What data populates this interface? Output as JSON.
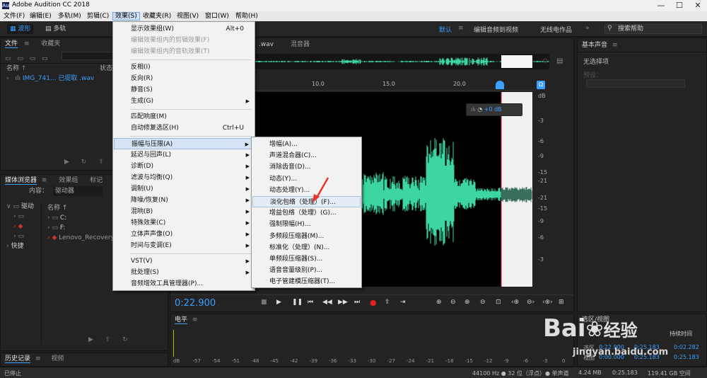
{
  "app": {
    "title": "Adobe Audition CC 2018",
    "icon_text": "Au"
  },
  "window": {
    "min": "—",
    "max": "☐",
    "close": "✕"
  },
  "menubar": [
    "文件(F)",
    "编辑(E)",
    "多轨(M)",
    "剪辑(C)",
    "效果(S)",
    "收藏夹(R)",
    "视图(V)",
    "窗口(W)",
    "帮助(H)"
  ],
  "toolbar": {
    "waveform": "波形",
    "multitrack": "多轨",
    "workspace_default": "默认",
    "workspace_edit": "编辑音频到视频",
    "workspace_radio": "无线电作品",
    "search_placeholder": "搜索帮助"
  },
  "files_panel": {
    "tab_files": "文件",
    "tab_favorites": "收藏夹",
    "col_name": "名称",
    "col_status": "状态",
    "file_name": "IMG_741... 已提取 .wav"
  },
  "media_panel": {
    "tab_browser": "媒体浏览器",
    "tab_effects": "效果组",
    "tab_markers": "标记",
    "content_label": "内容：",
    "content_value": "驱动器",
    "col_name": "名称",
    "tree_items": [
      "驱动",
      "",
      "",
      "快捷"
    ],
    "drives": [
      "C:",
      "F:",
      "Lenovo_Recovery"
    ]
  },
  "history_panel": {
    "tab_history": "历史记录",
    "tab_video": "视频"
  },
  "editor": {
    "tab_file": ".wav",
    "tab_mixer": "混音器",
    "ruler": [
      "10.0",
      "15.0",
      "20.0"
    ],
    "db_scale": [
      "dB",
      "-3",
      "-6",
      "-9",
      "-15",
      "-21",
      "-21",
      "-15",
      "-9",
      "-6",
      "-3"
    ],
    "gain": "+0 dB",
    "time": "0:22.900"
  },
  "effects_menu": {
    "items": [
      {
        "label": "显示效果组(W)",
        "shortcut": "Alt+0"
      },
      {
        "label": "编辑效果组内的剪辑效果(F)",
        "disabled": true
      },
      {
        "label": "编辑效果组内的音轨效果(T)",
        "disabled": true
      },
      {
        "label": "反相(I)"
      },
      {
        "label": "反向(R)"
      },
      {
        "label": "静音(S)"
      },
      {
        "label": "生成(G)",
        "submenu": true
      },
      {
        "label": "匹配响度(M)"
      },
      {
        "label": "自动修复选区(H)",
        "shortcut": "Ctrl+U"
      },
      {
        "label": "振幅与压限(A)",
        "submenu": true
      },
      {
        "label": "延迟与回声(L)",
        "submenu": true
      },
      {
        "label": "诊断(D)",
        "submenu": true
      },
      {
        "label": "滤波与均衡(Q)",
        "submenu": true
      },
      {
        "label": "调制(U)",
        "submenu": true
      },
      {
        "label": "降噪/恢复(N)",
        "submenu": true
      },
      {
        "label": "混响(B)",
        "submenu": true
      },
      {
        "label": "特殊效果(C)",
        "submenu": true
      },
      {
        "label": "立体声声像(O)",
        "submenu": true
      },
      {
        "label": "时间与变调(E)",
        "submenu": true
      },
      {
        "label": "VST(V)",
        "submenu": true
      },
      {
        "label": "批处理(S)",
        "submenu": true
      },
      {
        "label": "音频增效工具管理器(P)..."
      }
    ]
  },
  "amplitude_submenu": {
    "items": [
      "增幅(A)...",
      "声道混合器(C)...",
      "消除齿音(D)...",
      "动态(Y)...",
      "动态处理(Y)...",
      "淡化包络（处理）(F)...",
      "增益包络（处理）(G)...",
      "强制限幅(H)...",
      "多频段压缩器(M)...",
      "标准化（处理）(N)...",
      "单频段压缩器(S)...",
      "语音音量级别(P)...",
      "电子管建模压缩器(T)..."
    ]
  },
  "basic_panel": {
    "title": "基本声音",
    "no_selection": "无选择项",
    "preset_label": "预设："
  },
  "level_panel": {
    "title": "电平",
    "scale": [
      "dB",
      "-57",
      "-54",
      "-51",
      "-48",
      "-45",
      "-42",
      "-39",
      "-36",
      "-33",
      "-30",
      "-27",
      "-24",
      "-21",
      "-18",
      "-15",
      "-12",
      "-9",
      "-6",
      "-3",
      "0"
    ]
  },
  "selection_panel": {
    "title": "选区/视图",
    "col_duration": "持续时间",
    "row_selection": "选区",
    "row_view": "视图",
    "sel_start": "0:22.900",
    "sel_end": "0:25.183",
    "sel_dur": "0:02.282",
    "view_start": "0:00.000",
    "view_end": "0:25.183",
    "view_dur": "0:25.183"
  },
  "status": {
    "left": "已停止",
    "rate": "44100 Hz ● 32 位（浮点）● 单声道",
    "size": "4.24 MB",
    "dur": "0:25.183",
    "free": "119.41 GB 空间"
  },
  "watermark": {
    "brand": "Bai",
    "brand2": "经验",
    "url": "jingyan.baidu.com"
  },
  "colors": {
    "accent": "#3ba0ff",
    "waveform": "#3ed6a0",
    "record": "#e02020",
    "annotation_arrow": "#e8332a"
  }
}
